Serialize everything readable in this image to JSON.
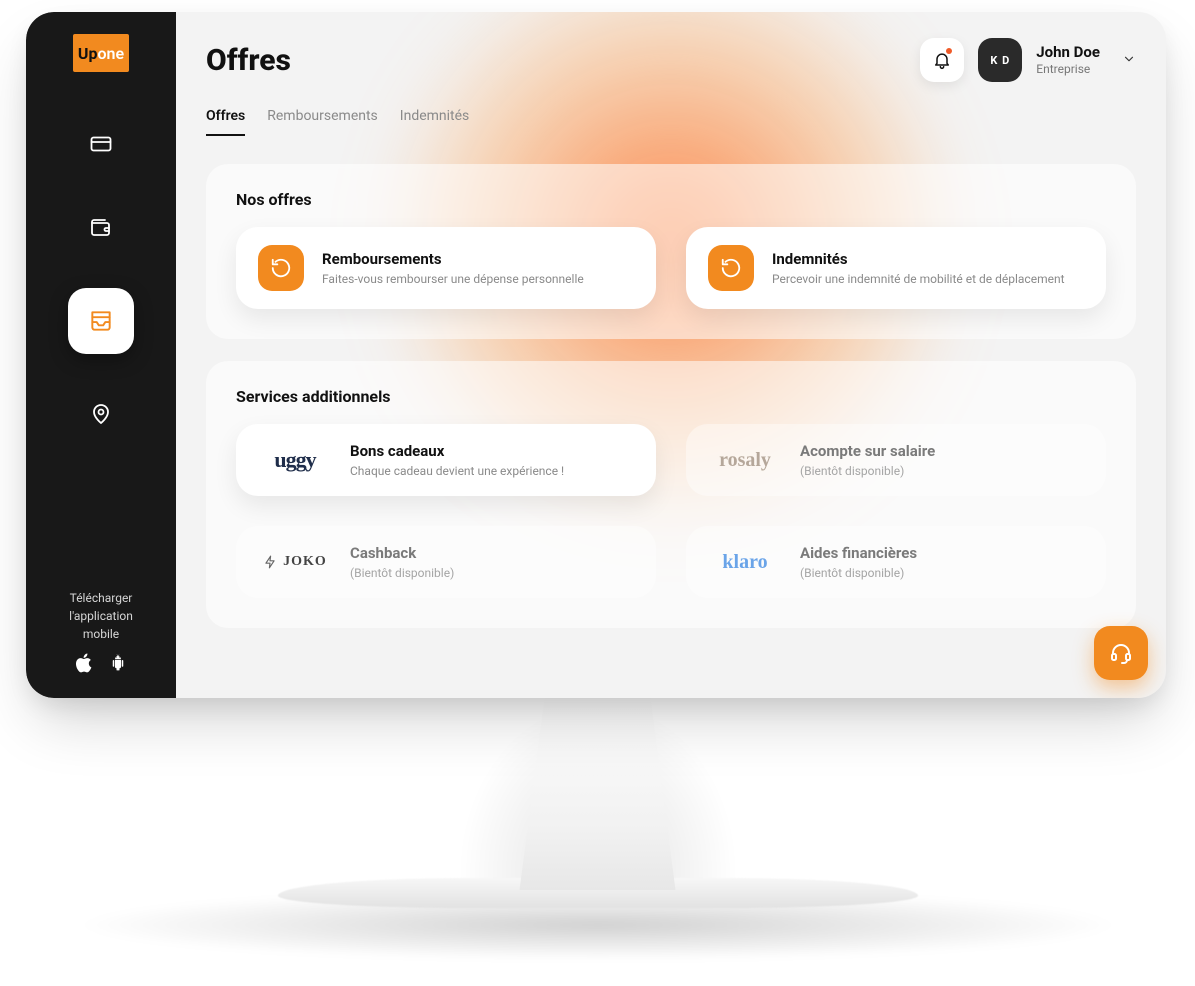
{
  "brand": {
    "prefix": "Up",
    "suffix": "one"
  },
  "header": {
    "title": "Offres",
    "user": {
      "initials": "K D",
      "name": "John Doe",
      "subtitle": "Entreprise"
    }
  },
  "tabs": [
    {
      "label": "Offres",
      "active": true
    },
    {
      "label": "Remboursements",
      "active": false
    },
    {
      "label": "Indemnités",
      "active": false
    }
  ],
  "offers_panel": {
    "title": "Nos offres",
    "cards": [
      {
        "title": "Remboursements",
        "subtitle": "Faites-vous rembourser une dépense personnelle"
      },
      {
        "title": "Indemnités",
        "subtitle": "Percevoir une indemnité de mobilité et de déplacement"
      }
    ]
  },
  "services_panel": {
    "title": "Services additionnels",
    "cards": [
      {
        "brand": "uggy",
        "title": "Bons cadeaux",
        "subtitle": "Chaque cadeau devient une expérience !",
        "disabled": false
      },
      {
        "brand": "rosaly",
        "title": "Acompte sur salaire",
        "subtitle": "(Bientôt disponible)",
        "disabled": true
      },
      {
        "brand": "JOKO",
        "title": "Cashback",
        "subtitle": "(Bientôt disponible)",
        "disabled": true
      },
      {
        "brand": "klaro",
        "title": "Aides financières",
        "subtitle": "(Bientôt disponible)",
        "disabled": true
      }
    ]
  },
  "sidebar_footer": {
    "line1": "Télécharger",
    "line2": "l'application",
    "line3": "mobile"
  }
}
